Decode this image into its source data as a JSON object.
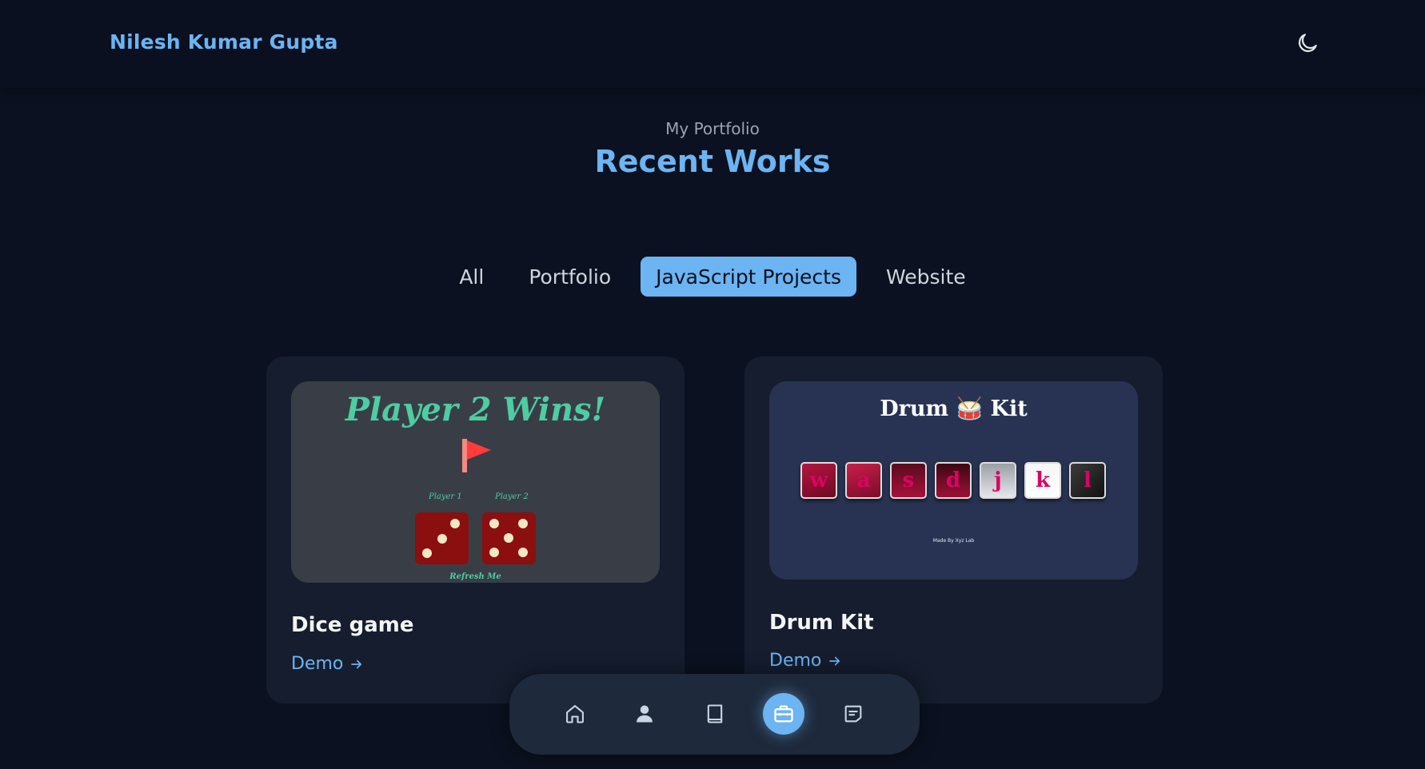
{
  "header": {
    "brand": "Nilesh Kumar Gupta",
    "theme_toggle_icon": "moon-icon"
  },
  "section": {
    "subtitle": "My Portfolio",
    "title": "Recent Works"
  },
  "filters": [
    {
      "label": "All",
      "active": false
    },
    {
      "label": "Portfolio",
      "active": false
    },
    {
      "label": "JavaScript Projects",
      "active": true
    },
    {
      "label": "Website",
      "active": false
    }
  ],
  "projects": [
    {
      "title": "Dice game",
      "link_label": "Demo",
      "thumbnail": {
        "heading": "Player 2 Wins!",
        "player1_label": "Player 1",
        "player2_label": "Player 2",
        "die1": 3,
        "die2": 5,
        "footer": "Refresh Me"
      }
    },
    {
      "title": "Drum Kit",
      "link_label": "Demo",
      "thumbnail": {
        "heading": "Drum 🥁 Kit",
        "keys": [
          "w",
          "a",
          "s",
          "d",
          "j",
          "k",
          "l"
        ],
        "credit": "Made By Xyz Lab"
      }
    }
  ],
  "bottom_nav": [
    {
      "icon": "home-icon",
      "active": false
    },
    {
      "icon": "user-icon",
      "active": false
    },
    {
      "icon": "book-icon",
      "active": false
    },
    {
      "icon": "briefcase-icon",
      "active": true
    },
    {
      "icon": "message-icon",
      "active": false
    }
  ],
  "colors": {
    "background": "#0b1120",
    "accent": "#6cb4f2",
    "card": "#151d2e",
    "nav": "#1e293b"
  }
}
